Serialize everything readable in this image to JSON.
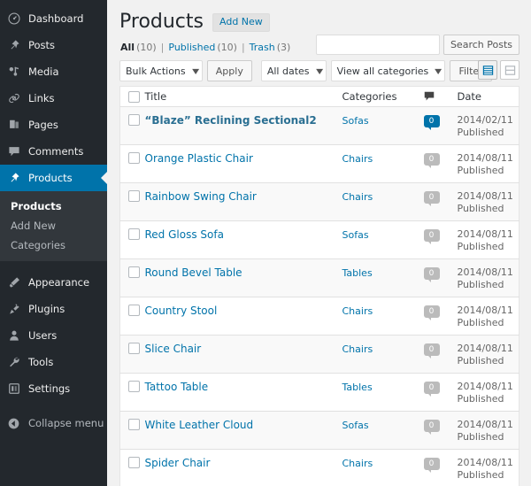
{
  "sidebar": {
    "items": [
      {
        "label": "Dashboard",
        "icon": "dashboard-icon",
        "active": false
      },
      {
        "label": "Posts",
        "icon": "pin-icon",
        "active": false
      },
      {
        "label": "Media",
        "icon": "media-icon",
        "active": false
      },
      {
        "label": "Links",
        "icon": "link-icon",
        "active": false
      },
      {
        "label": "Pages",
        "icon": "pages-icon",
        "active": false
      },
      {
        "label": "Comments",
        "icon": "comment-icon",
        "active": false
      },
      {
        "label": "Products",
        "icon": "pin-icon",
        "active": true
      }
    ],
    "submenu": [
      {
        "label": "Products",
        "current": true
      },
      {
        "label": "Add New",
        "current": false
      },
      {
        "label": "Categories",
        "current": false
      }
    ],
    "items_lower": [
      {
        "label": "Appearance",
        "icon": "brush-icon"
      },
      {
        "label": "Plugins",
        "icon": "plug-icon"
      },
      {
        "label": "Users",
        "icon": "user-icon"
      },
      {
        "label": "Tools",
        "icon": "wrench-icon"
      },
      {
        "label": "Settings",
        "icon": "settings-icon"
      }
    ],
    "collapse": {
      "label": "Collapse menu",
      "icon": "collapse-icon"
    },
    "active_color": "#0073aa",
    "background": "#23282d",
    "submenu_background": "#32373c"
  },
  "header": {
    "title": "Products",
    "add_new_label": "Add New"
  },
  "statuses": [
    {
      "label": "All",
      "count": "(10)",
      "current": true
    },
    {
      "label": "Published",
      "count": "(10)",
      "current": false
    },
    {
      "label": "Trash",
      "count": "(3)",
      "current": false
    }
  ],
  "search": {
    "value": "",
    "placeholder": "",
    "button_label": "Search Posts"
  },
  "toolbar": {
    "bulk_actions": "Bulk Actions",
    "apply_label": "Apply",
    "all_dates": "All dates",
    "all_categories": "View all categories",
    "filter_label": "Filter",
    "view_list": "list-view",
    "view_excerpt": "excerpt-view"
  },
  "table": {
    "columns": {
      "title": "Title",
      "categories": "Categories",
      "comments": "comment-icon",
      "date": "Date"
    },
    "rows": [
      {
        "title": "“Blaze” Reclining Sectional2",
        "bold": true,
        "category": "Sofas",
        "comments": "0",
        "comments_active": true,
        "date": "2014/02/11",
        "status": "Published"
      },
      {
        "title": "Orange Plastic Chair",
        "bold": false,
        "category": "Chairs",
        "comments": "0",
        "comments_active": false,
        "date": "2014/08/11",
        "status": "Published"
      },
      {
        "title": "Rainbow Swing Chair",
        "bold": false,
        "category": "Chairs",
        "comments": "0",
        "comments_active": false,
        "date": "2014/08/11",
        "status": "Published"
      },
      {
        "title": "Red Gloss Sofa",
        "bold": false,
        "category": "Sofas",
        "comments": "0",
        "comments_active": false,
        "date": "2014/08/11",
        "status": "Published"
      },
      {
        "title": "Round Bevel Table",
        "bold": false,
        "category": "Tables",
        "comments": "0",
        "comments_active": false,
        "date": "2014/08/11",
        "status": "Published"
      },
      {
        "title": "Country Stool",
        "bold": false,
        "category": "Chairs",
        "comments": "0",
        "comments_active": false,
        "date": "2014/08/11",
        "status": "Published"
      },
      {
        "title": "Slice Chair",
        "bold": false,
        "category": "Chairs",
        "comments": "0",
        "comments_active": false,
        "date": "2014/08/11",
        "status": "Published"
      },
      {
        "title": "Tattoo Table",
        "bold": false,
        "category": "Tables",
        "comments": "0",
        "comments_active": false,
        "date": "2014/08/11",
        "status": "Published"
      },
      {
        "title": "White Leather Cloud",
        "bold": false,
        "category": "Sofas",
        "comments": "0",
        "comments_active": false,
        "date": "2014/08/11",
        "status": "Published"
      },
      {
        "title": "Spider Chair",
        "bold": false,
        "category": "Chairs",
        "comments": "0",
        "comments_active": false,
        "date": "2014/08/11",
        "status": "Published"
      }
    ]
  },
  "colors": {
    "accent": "#0073aa",
    "link": "#0073aa",
    "sidebar_bg": "#23282d",
    "row_alt": "#f9f9f9",
    "page_bg": "#f1f1f1"
  }
}
